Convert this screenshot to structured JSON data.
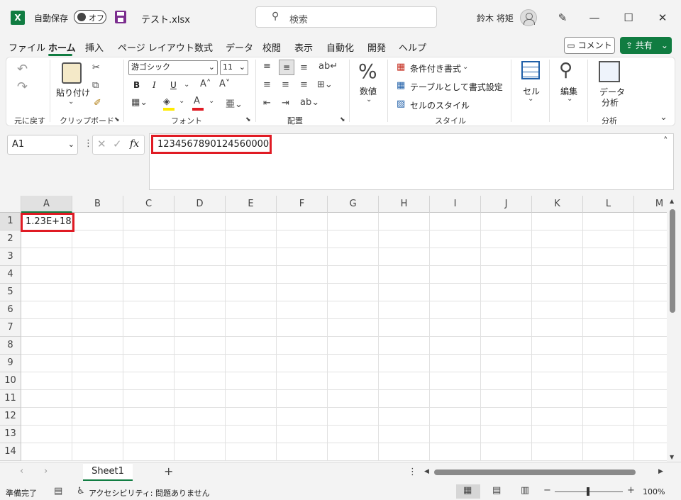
{
  "titlebar": {
    "autosave_label": "自動保存",
    "autosave_state": "オフ",
    "filename": "テスト.xlsx",
    "search_placeholder": "検索",
    "user_name": "鈴木 将矩"
  },
  "menu": [
    "ファイル",
    "ホーム",
    "挿入",
    "ページ レイアウト",
    "数式",
    "データ",
    "校閲",
    "表示",
    "自動化",
    "開発",
    "ヘルプ"
  ],
  "menu_active": "ホーム",
  "comment_button": "コメント",
  "share_button": "共有",
  "ribbon": {
    "undo_group": "元に戻す",
    "clipboard": {
      "paste": "貼り付け",
      "group": "クリップボード"
    },
    "font": {
      "name": "游ゴシック",
      "size": "11",
      "group": "フォント",
      "bold": "B",
      "italic": "I",
      "underline": "U"
    },
    "alignment": {
      "group": "配置"
    },
    "number": {
      "label": "数値"
    },
    "styles": {
      "conditional": "条件付き書式",
      "table": "テーブルとして書式設定",
      "cell_style": "セルのスタイル",
      "group": "スタイル"
    },
    "cells": "セル",
    "editing": "編集",
    "analyze": {
      "line1": "データ",
      "line2": "分析",
      "group": "分析"
    }
  },
  "formula_bar": {
    "name_box": "A1",
    "fx": "fx",
    "formula": "1234567890124560000"
  },
  "grid": {
    "columns": [
      "A",
      "B",
      "C",
      "D",
      "E",
      "F",
      "G",
      "H",
      "I",
      "J",
      "K",
      "L",
      "M"
    ],
    "rows": [
      "1",
      "2",
      "3",
      "4",
      "5",
      "6",
      "7",
      "8",
      "9",
      "10",
      "11",
      "12",
      "13",
      "14"
    ],
    "cell_a1": "1.23E+18"
  },
  "sheet_tab": "Sheet1",
  "status": {
    "ready": "準備完了",
    "accessibility": "アクセシビリティ: 問題ありません",
    "zoom": "100%"
  },
  "colors": {
    "excel_green": "#107c41",
    "highlight_red": "#e01b24"
  }
}
